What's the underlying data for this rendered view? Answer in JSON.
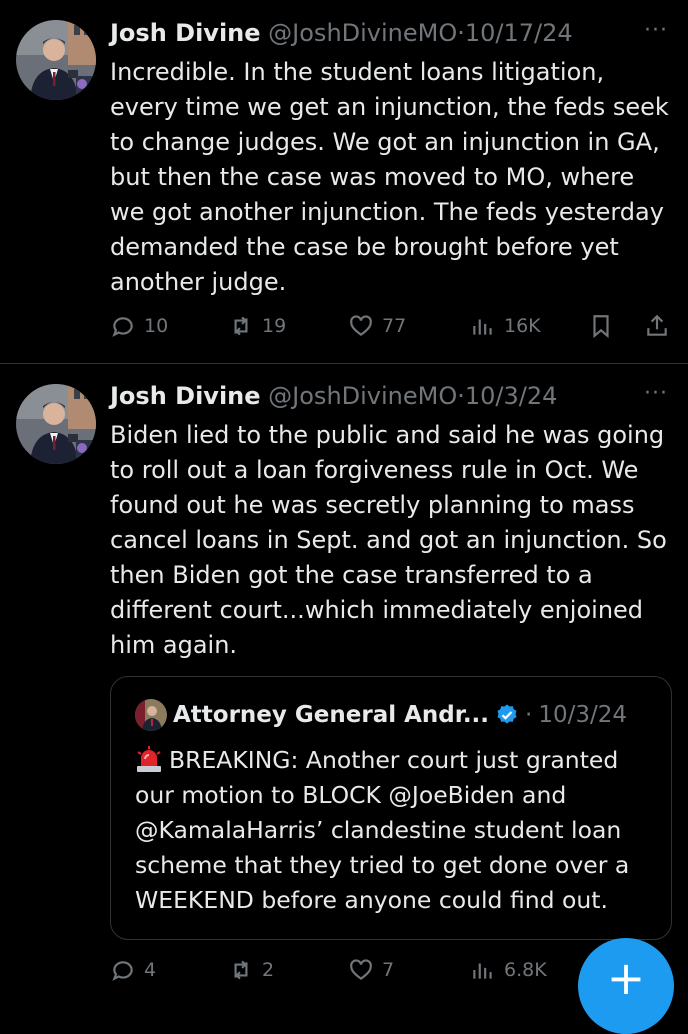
{
  "tweets": [
    {
      "name": "Josh Divine",
      "handle": "@JoshDivineMO",
      "separator": "·",
      "date": "10/17/24",
      "more": "···",
      "text": "Incredible. In the student loans litigation, every time we get an injunction, the feds seek to change judges. We got an injunction in GA, but then the case was moved to MO, where we got another injunction. The feds yesterday demanded the case be brought before yet another judge.",
      "replies": "10",
      "reposts": "19",
      "likes": "77",
      "views": "16K"
    },
    {
      "name": "Josh Divine",
      "handle": "@JoshDivineMO",
      "separator": "·",
      "date": "10/3/24",
      "more": "···",
      "text": "Biden lied to the public and said he was going to roll out a loan forgiveness rule in Oct. We found out he was secretly planning to mass cancel loans in Sept. and got an injunction. So then Biden got the case transferred to a different court...which immediately enjoined him again.",
      "replies": "4",
      "reposts": "2",
      "likes": "7",
      "views": "6.8K",
      "quote": {
        "name": "Attorney General Andr...",
        "separator": "·",
        "date": "10/3/24",
        "text": "BREAKING: Another court just granted our motion to BLOCK @JoeBiden and @KamalaHarris’ clandestine student loan scheme that they tried to get done over a WEEKEND before anyone could find out."
      }
    }
  ],
  "fab": {
    "label": "+"
  },
  "colors": {
    "accent": "#1d9bf0",
    "muted": "#71767b",
    "text": "#e7e9ea",
    "border": "#2f3336"
  },
  "icons": [
    "reply-icon",
    "repost-icon",
    "like-icon",
    "views-icon",
    "bookmark-icon",
    "share-icon",
    "verified-badge-icon",
    "siren-icon",
    "more-icon"
  ]
}
